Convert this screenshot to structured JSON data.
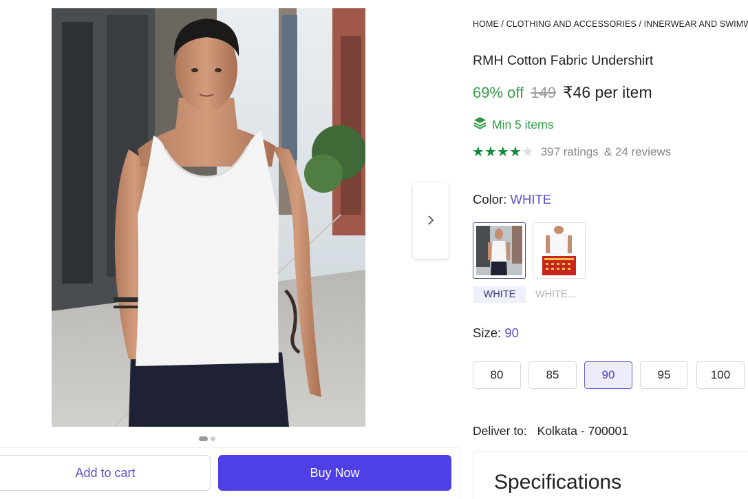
{
  "gallery": {
    "next_icon": "chevron-right-icon",
    "dots_count": 2,
    "active_dot": 0
  },
  "actions": {
    "add_to_cart": "Add to cart",
    "buy_now": "Buy Now"
  },
  "product": {
    "breadcrumb": "HOME / CLOTHING AND ACCESSORIES / INNERWEAR AND SWIMWEAR",
    "title": "RMH Cotton Fabric Undershirt",
    "discount": "69% off",
    "mrp": "149",
    "price": "₹46 per item",
    "min_items": "Min 5 items",
    "rating_stars": 4,
    "ratings": "397 ratings",
    "reviews": "& 24 reviews"
  },
  "color": {
    "label": "Color:",
    "selected": "WHITE",
    "options": [
      "WHITE",
      "WHITE..."
    ]
  },
  "size": {
    "label": "Size:",
    "selected": "90",
    "options": [
      "80",
      "85",
      "90",
      "95",
      "100"
    ]
  },
  "delivery": {
    "label": "Deliver to:",
    "location": "Kolkata - 700001"
  },
  "specifications": {
    "title": "Specifications"
  },
  "colors": {
    "accent": "#5a4fcf",
    "buy_button": "#4e3fe6",
    "discount_green": "#3a9b4a",
    "star_green": "#118a3b"
  }
}
